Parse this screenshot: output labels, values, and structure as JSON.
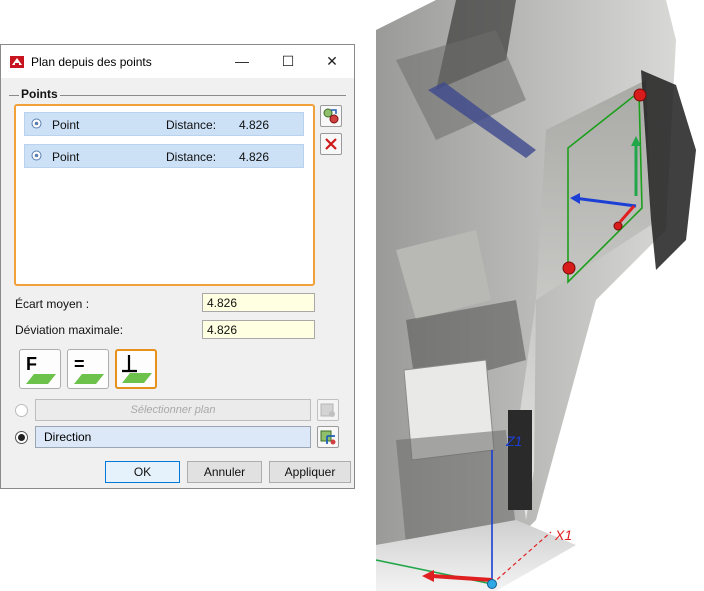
{
  "dialog": {
    "title": "Plan depuis des points",
    "minimize_glyph": "—",
    "maximize_glyph": "☐",
    "close_glyph": "✕",
    "group_title": "Points",
    "points": [
      {
        "name": "Point",
        "distance_label": "Distance:",
        "distance_value": "4.826"
      },
      {
        "name": "Point",
        "distance_label": "Distance:",
        "distance_value": "4.826"
      }
    ],
    "mean_deviation_label": "Écart moyen :",
    "mean_deviation_value": "4.826",
    "max_deviation_label": "Déviation maximale:",
    "max_deviation_value": "4.826",
    "mode_buttons": [
      {
        "letter": "F",
        "icon": "plane-f-icon",
        "active": false
      },
      {
        "letter": "=",
        "icon": "plane-parallel-icon",
        "active": false
      },
      {
        "letter": "⊥",
        "icon": "plane-perpendicular-icon",
        "active": true
      }
    ],
    "select_plane_placeholder": "Sélectionner plan",
    "direction_value": "Direction",
    "ok_label": "OK",
    "cancel_label": "Annuler",
    "apply_label": "Appliquer"
  },
  "viewport": {
    "axis_z_label": "Z1",
    "axis_x_label": "X1",
    "axis_colors": {
      "x": "#e02020",
      "y": "#22a64a",
      "z": "#1c3fd6",
      "plane": "#1ca01c"
    }
  }
}
